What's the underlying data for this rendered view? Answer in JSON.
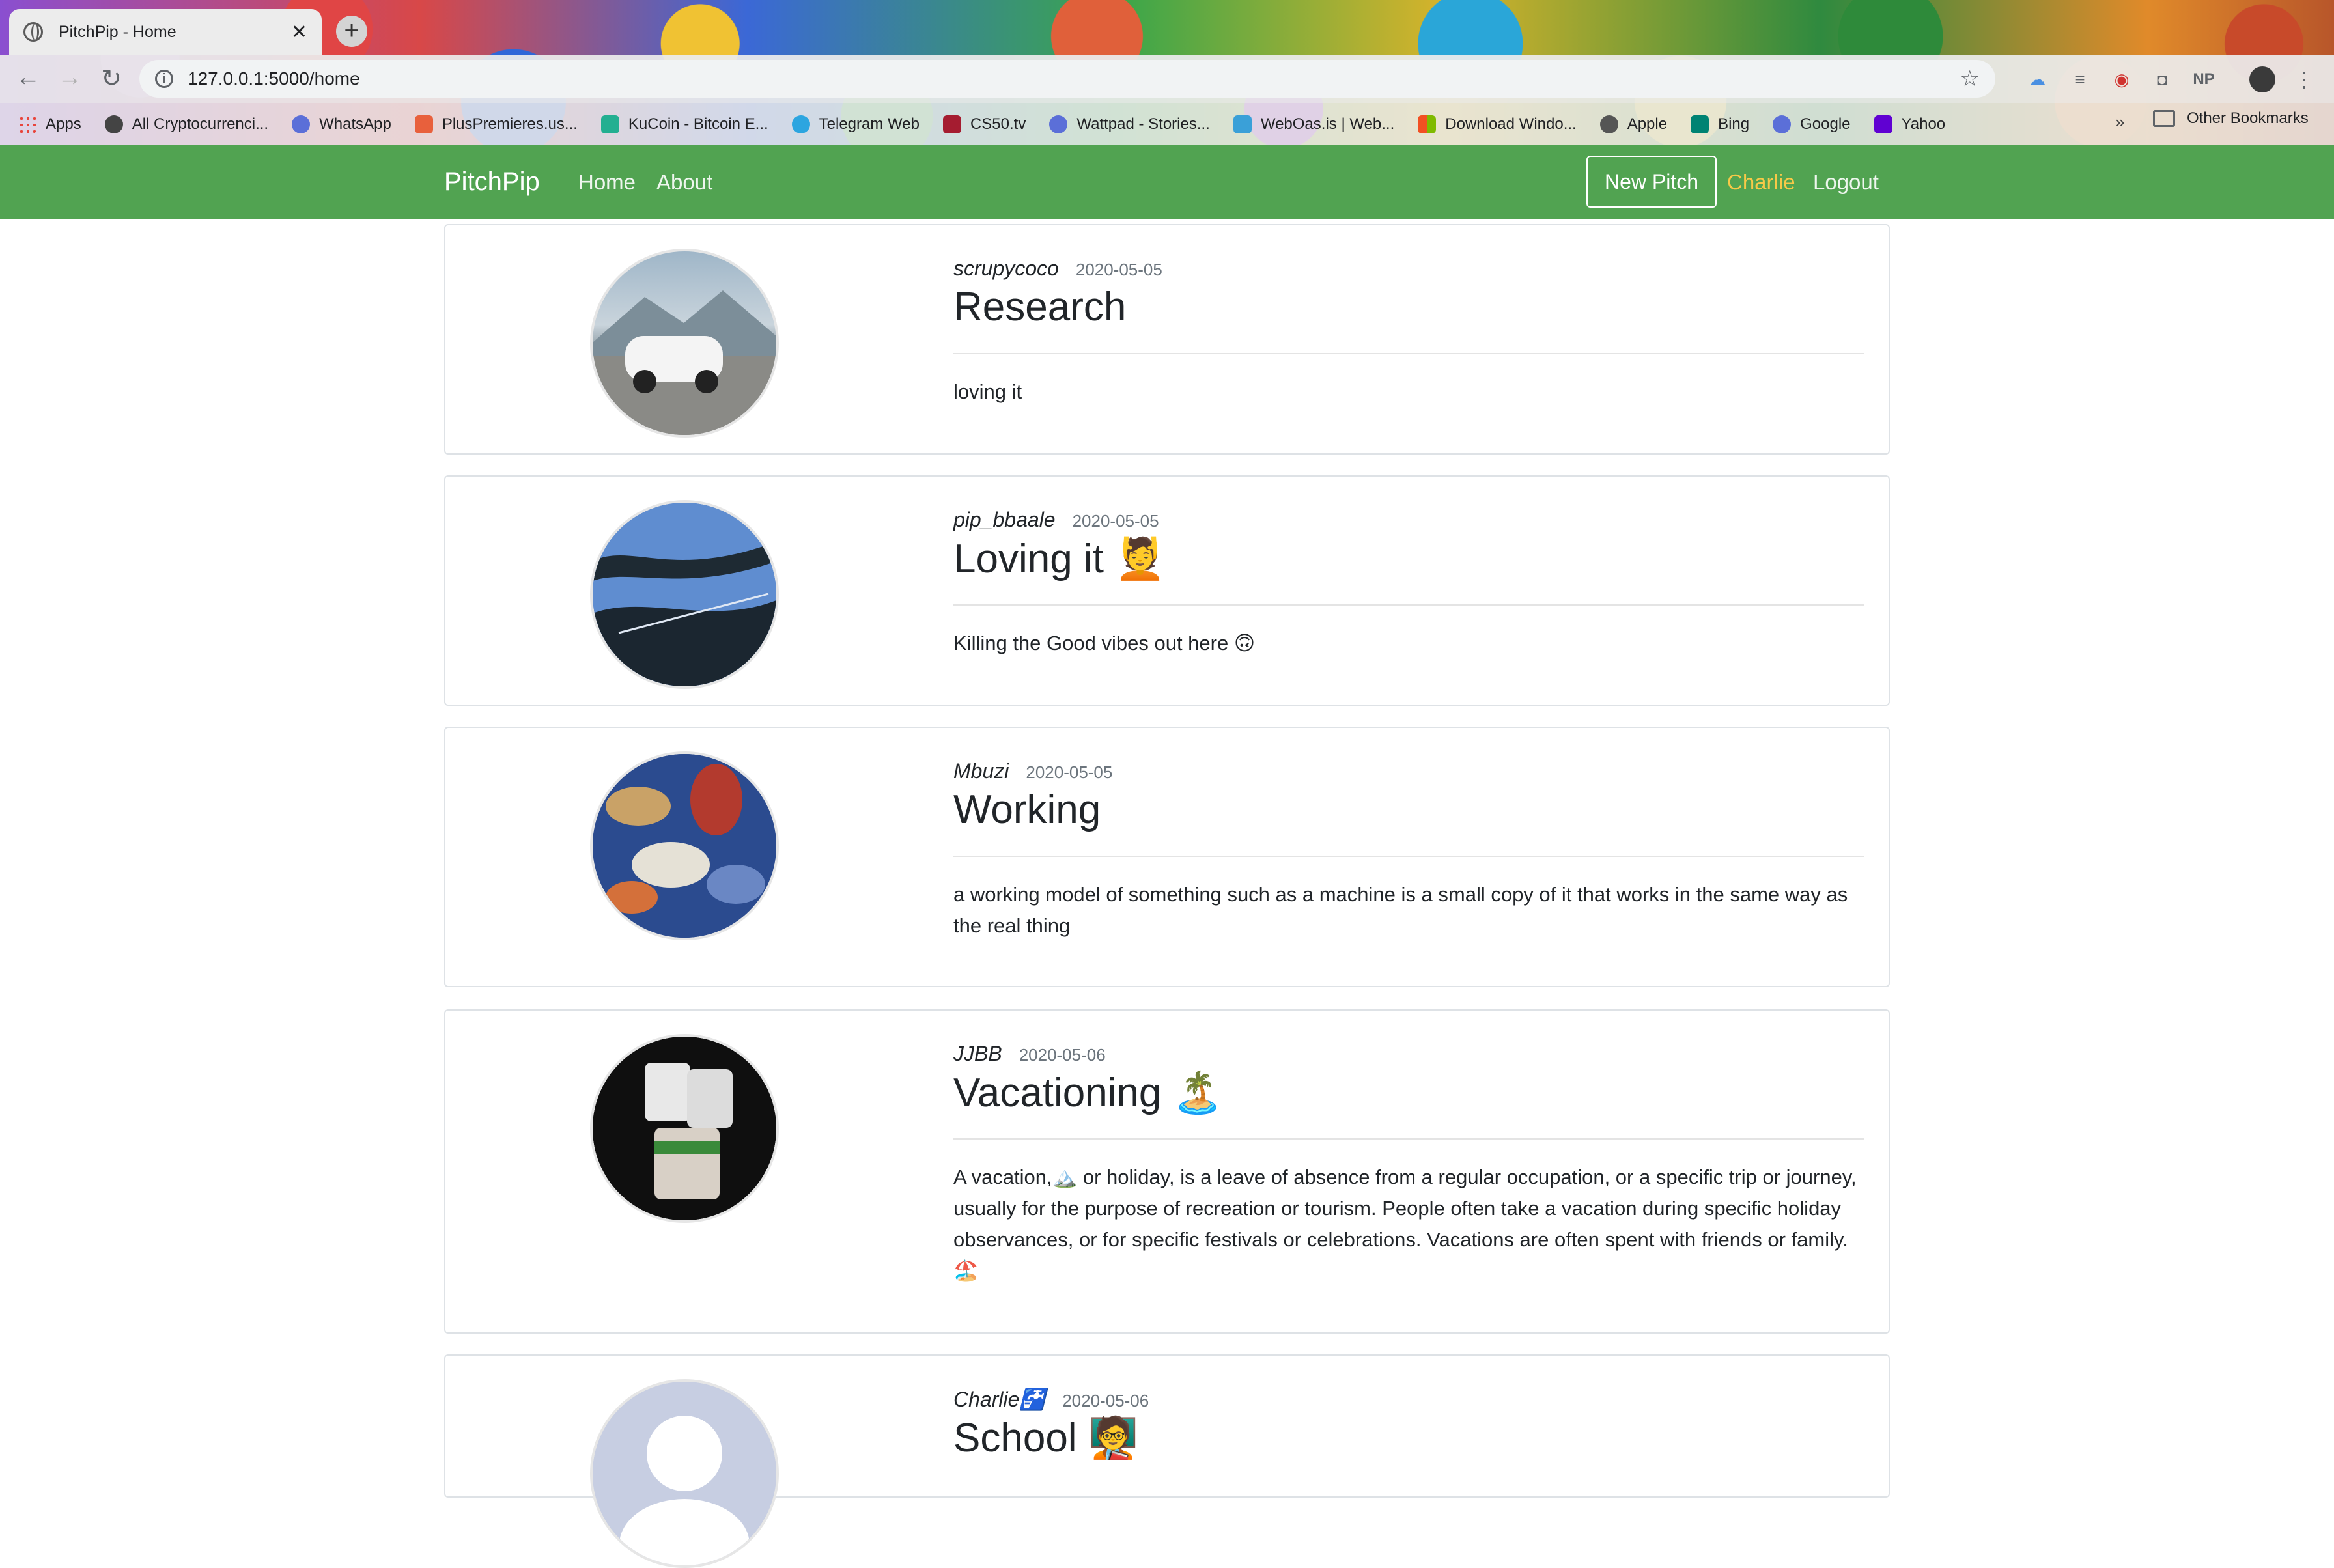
{
  "browser": {
    "tab_title": "PitchPip - Home",
    "tab_close": "✕",
    "new_tab": "+",
    "url": "127.0.0.1:5000/home",
    "bookmarks": [
      {
        "label": "Apps",
        "color": "#e8453c"
      },
      {
        "label": "All Cryptocurrenci...",
        "color": "#444444"
      },
      {
        "label": "WhatsApp",
        "color": "#5b6fd8"
      },
      {
        "label": "PlusPremieres.us...",
        "color": "#e8603c"
      },
      {
        "label": "KuCoin - Bitcoin E...",
        "color": "#23af91"
      },
      {
        "label": "Telegram Web",
        "color": "#2ca5e0"
      },
      {
        "label": "CS50.tv",
        "color": "#a51c30"
      },
      {
        "label": "Wattpad - Stories...",
        "color": "#5b6fd8"
      },
      {
        "label": "WebOas.is | Web...",
        "color": "#3aa0d8"
      },
      {
        "label": "Download Windo...",
        "color": "#f25022"
      },
      {
        "label": "Apple",
        "color": "#555555"
      },
      {
        "label": "Bing",
        "color": "#008373"
      },
      {
        "label": "Google",
        "color": "#5b6fd8"
      },
      {
        "label": "Yahoo",
        "color": "#6001d2"
      }
    ],
    "more": "»",
    "other_bookmarks": "Other Bookmarks"
  },
  "navbar": {
    "brand": "PitchPip",
    "links": [
      "Home",
      "About"
    ],
    "new_pitch": "New Pitch",
    "user": "Charlie",
    "logout": "Logout",
    "bg_color": "#51a351",
    "user_color": "#f7c948"
  },
  "pitches": [
    {
      "author": "scrupycoco",
      "date": "2020-05-05",
      "title": "Research",
      "body": "loving it",
      "avatar": "car-photo"
    },
    {
      "author": "pip_bbaale",
      "date": "2020-05-05",
      "title": "Loving it 💆",
      "body": "Killing the Good vibes out here 🙃",
      "avatar": "tree-sky-photo"
    },
    {
      "author": "Mbuzi",
      "date": "2020-05-05",
      "title": "Working",
      "body": "a working model of something such as a machine is a small copy of it that works in the same way as the real thing",
      "avatar": "abstract-art-photo"
    },
    {
      "author": "JJBB",
      "date": "2020-05-06",
      "title": "Vacationing 🏝️",
      "body": "A vacation,🏔️ or holiday, is a leave of absence from a regular occupation, or a specific trip or journey, usually for the purpose of recreation or tourism. People often take a vacation during specific holiday observances, or for specific festivals or celebrations. Vacations are often spent with friends or family.🏖️",
      "avatar": "toilet-paper-photo"
    },
    {
      "author": "Charlie🚰",
      "date": "2020-05-06",
      "title": "School 🧑‍🏫",
      "body": "",
      "avatar": "default-user-silhouette"
    }
  ]
}
